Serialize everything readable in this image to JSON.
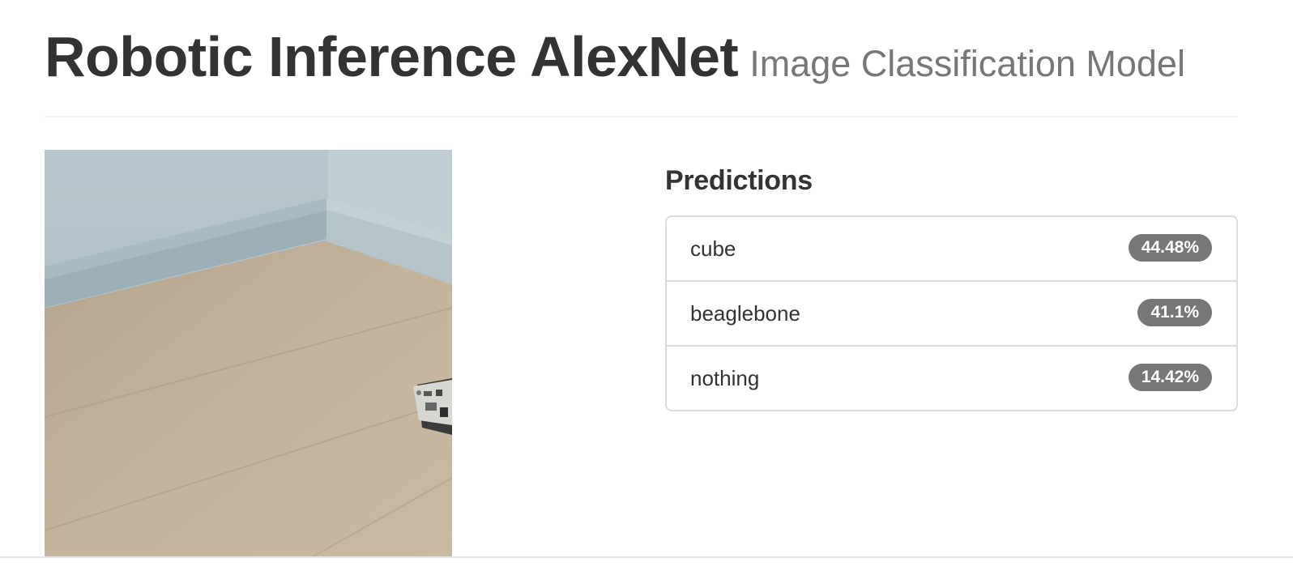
{
  "header": {
    "title": "Robotic Inference AlexNet",
    "subtitle": "Image Classification Model"
  },
  "image": {
    "description_icon": "camera-frame-image"
  },
  "predictions": {
    "heading": "Predictions",
    "items": [
      {
        "label": "cube",
        "probability": "44.48%"
      },
      {
        "label": "beaglebone",
        "probability": "41.1%"
      },
      {
        "label": "nothing",
        "probability": "14.42%"
      }
    ]
  },
  "colors": {
    "text": "#333333",
    "subtitle": "#777777",
    "badge": "#777777",
    "border": "#dddddd"
  }
}
